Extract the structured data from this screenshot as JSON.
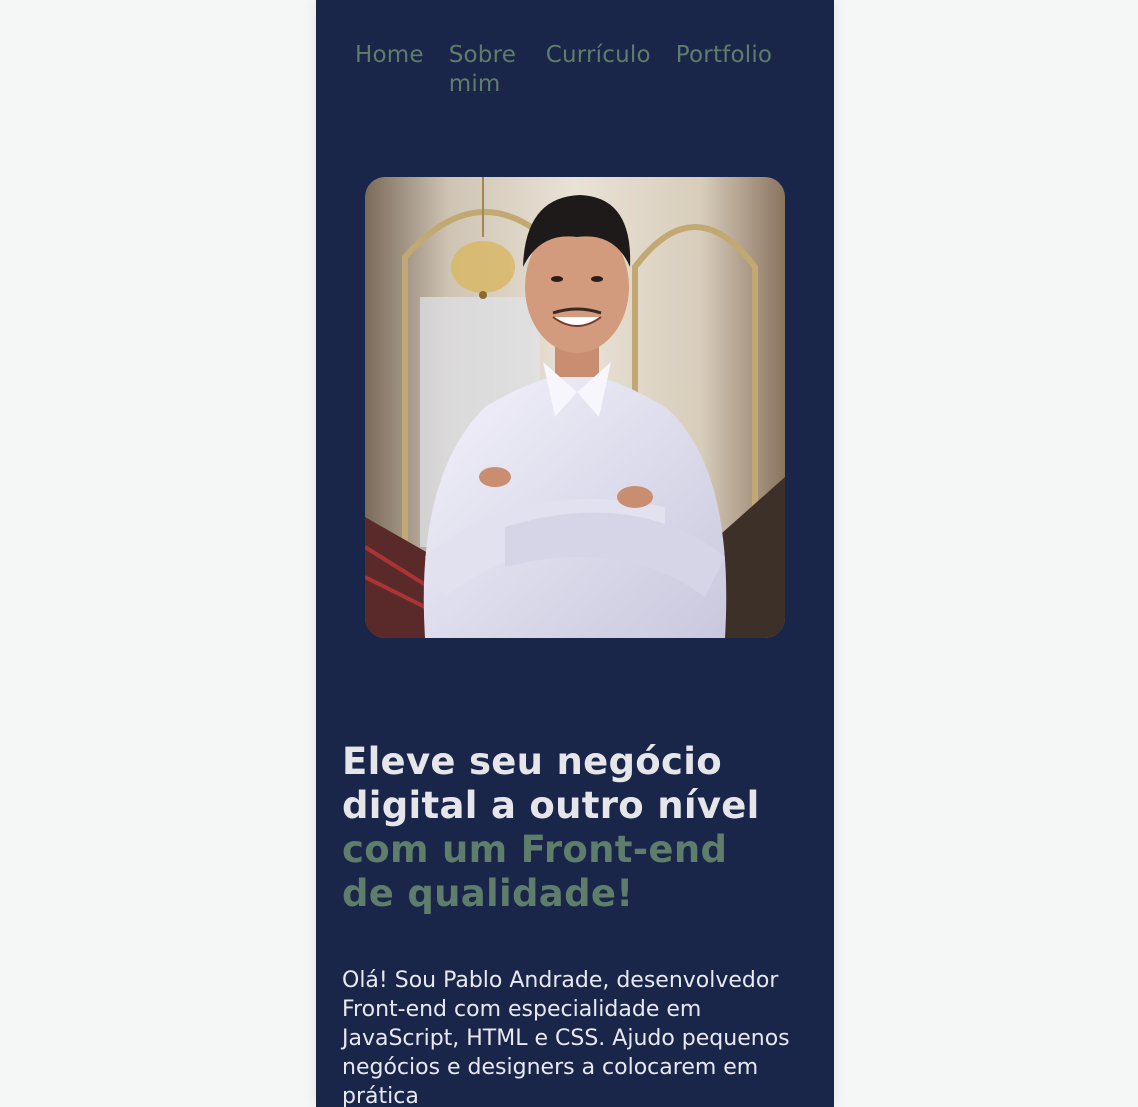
{
  "nav": {
    "home": "Home",
    "about": "Sobre mim",
    "resume": "Currículo",
    "portfolio": "Portfolio"
  },
  "hero": {
    "title_line1": "Eleve seu negócio",
    "title_line2": "digital a outro nível",
    "title_accent1": "com um Front-end",
    "title_accent2": "de qualidade!",
    "intro": "Olá! Sou Pablo Andrade, desenvolvedor Front-end com especialidade em JavaScript, HTML e CSS. Ajudo pequenos negócios e designers a colocarem em prática"
  },
  "colors": {
    "background": "#19264a",
    "accent": "#5e7d6a",
    "text": "#e6e6ea"
  }
}
